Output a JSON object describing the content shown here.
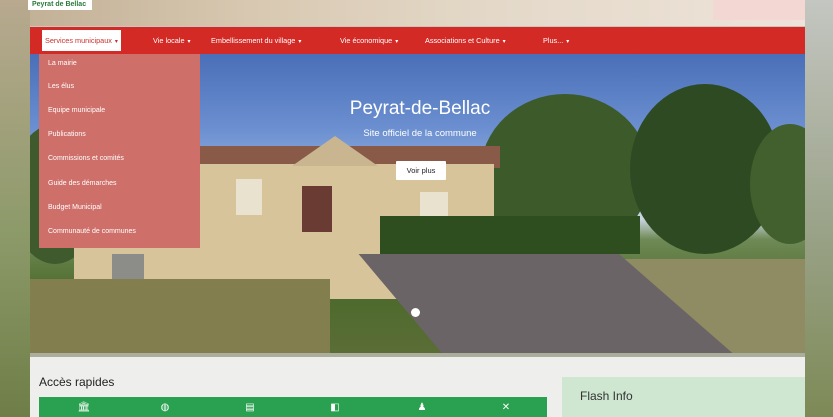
{
  "site_tag": "Peyrat de Bellac",
  "nav": {
    "items": [
      {
        "label": "Services municipaux",
        "caret": "▾"
      },
      {
        "label": "Vie locale",
        "caret": "▾"
      },
      {
        "label": "Embellissement du village",
        "caret": "▾"
      },
      {
        "label": "Vie économique",
        "caret": "▾"
      },
      {
        "label": "Associations et Culture",
        "caret": "▾"
      },
      {
        "label": "Plus...",
        "caret": "▾"
      }
    ]
  },
  "dropdown": {
    "items": [
      "La mairie",
      "Les élus",
      "Equipe municipale",
      "Publications",
      "Commissions et comités",
      "Guide des démarches",
      "Budget Municipal",
      "Communauté de communes"
    ]
  },
  "hero": {
    "title": "Peyrat-de-Bellac",
    "subtitle": "Site officiel de la commune",
    "button": "Voir plus"
  },
  "quick_access": {
    "title": "Accès rapides",
    "icons": [
      "bank-icon",
      "globe-icon",
      "document-icon",
      "book-icon",
      "user-icon",
      "tools-icon"
    ]
  },
  "flash": {
    "title": "Flash Info"
  },
  "colors": {
    "nav_red": "#d32a26",
    "dropdown": "#cf6f6a",
    "green": "#2aa150",
    "flash_bg": "#cfe6d1"
  }
}
